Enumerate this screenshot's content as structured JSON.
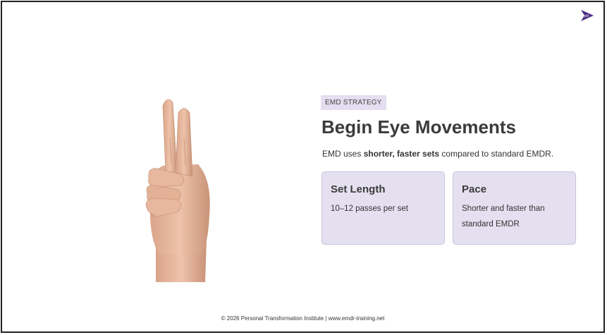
{
  "badge": "EMD STRATEGY",
  "title": "Begin Eye Movements",
  "subtitle": {
    "pre": "EMD uses ",
    "bold": "shorter, faster sets",
    "post": " compared to standard EMDR."
  },
  "cards": [
    {
      "title": "Set Length",
      "text": "10–12 passes per set"
    },
    {
      "title": "Pace",
      "text": "Shorter and faster than standard EMDR"
    }
  ],
  "footer": "© 2026 Personal Transformation Institute | www.emdr-training.net",
  "logo": {
    "icon": "pti-logo-icon",
    "text": "pti"
  },
  "image": {
    "name": "two-fingers-hand-image"
  },
  "colors": {
    "card_bg": "#e5e0f0",
    "badge_bg": "#e4def0",
    "logo": "#4b2d84"
  }
}
